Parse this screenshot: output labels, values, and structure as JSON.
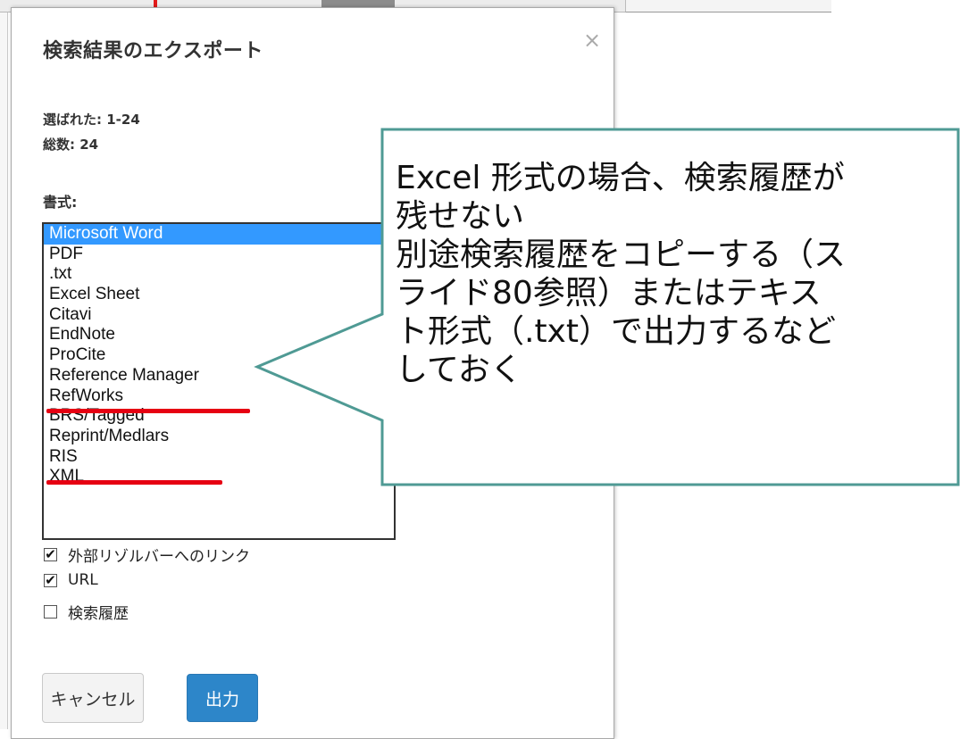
{
  "dialog": {
    "title": "検索結果のエクスポート",
    "close_glyph": "×",
    "selected_label": "選ばれた: 1-24",
    "total_label": "総数: 24",
    "format_label": "書式:",
    "formats": [
      "Microsoft Word",
      "PDF",
      ".txt",
      "Excel Sheet",
      "Citavi",
      "EndNote",
      "ProCite",
      "Reference Manager",
      "RefWorks",
      "BRS/Tagged",
      "Reprint/Medlars",
      "RIS",
      "XML"
    ],
    "selected_format": "Microsoft Word",
    "underlined_formats": [
      "Reference Manager",
      "Reprint/Medlars"
    ],
    "options": [
      {
        "label": "外部リゾルバーへのリンク",
        "checked": true,
        "glyph": "✔"
      },
      {
        "label": "URL",
        "checked": true,
        "glyph": "✔"
      },
      {
        "label": "検索履歴",
        "checked": false,
        "glyph": ""
      }
    ],
    "cancel_label": "キャンセル",
    "export_label": "出力"
  },
  "callout": {
    "lines": [
      "Excel 形式の場合、検索履歴が",
      "残せない",
      "別途検索履歴をコピーする（ス",
      "ライド80参照）またはテキス",
      "ト形式（.txt）で出力するなど",
      "しておく"
    ]
  },
  "colors": {
    "callout_border": "#4f9a94",
    "selection": "#3399ff",
    "export_button": "#2d86c9",
    "annotation_red": "#e60012"
  }
}
